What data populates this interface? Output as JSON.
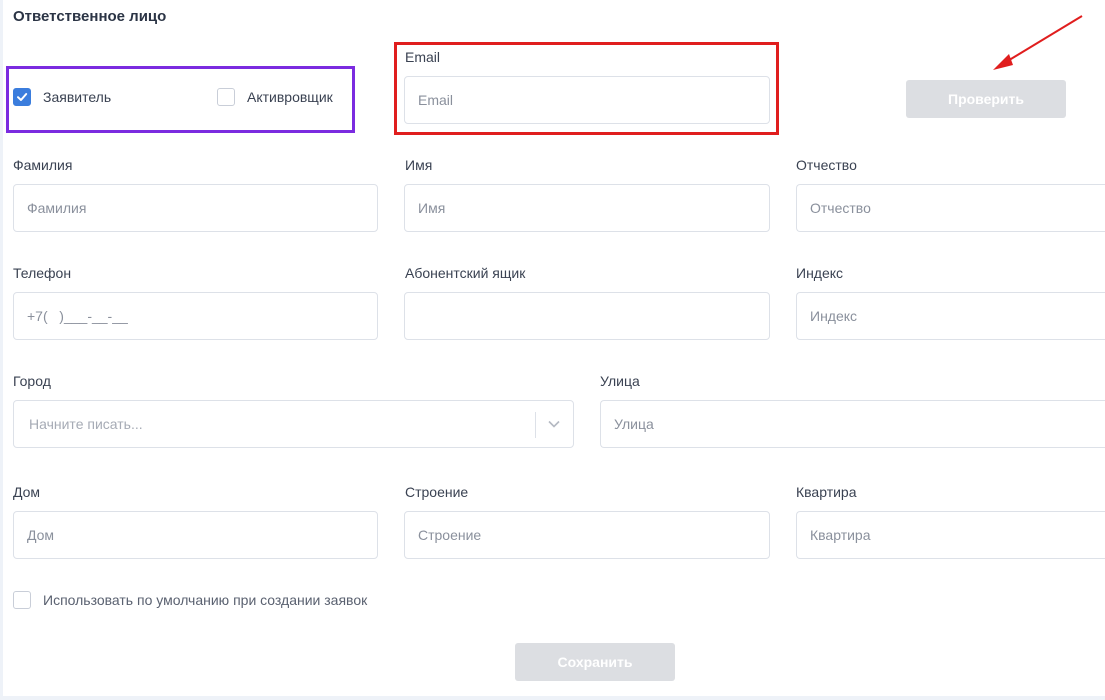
{
  "section_title": "Ответственное лицо",
  "role": {
    "applicant_label": "Заявитель",
    "activator_label": "Активровщик"
  },
  "email": {
    "label": "Email",
    "placeholder": "Email"
  },
  "check_button": "Проверить",
  "fields": {
    "last_name": {
      "label": "Фамилия",
      "placeholder": "Фамилия"
    },
    "first_name": {
      "label": "Имя",
      "placeholder": "Имя"
    },
    "middle_name": {
      "label": "Отчество",
      "placeholder": "Отчество"
    },
    "phone": {
      "label": "Телефон",
      "value": "+7(   )___-__-__"
    },
    "po_box": {
      "label": "Абонентский ящик",
      "value": ""
    },
    "index": {
      "label": "Индекс",
      "placeholder": "Индекс"
    },
    "city": {
      "label": "Город",
      "placeholder": "Начните писать..."
    },
    "street": {
      "label": "Улица",
      "placeholder": "Улица"
    },
    "house": {
      "label": "Дом",
      "placeholder": "Дом"
    },
    "building": {
      "label": "Строение",
      "placeholder": "Строение"
    },
    "apartment": {
      "label": "Квартира",
      "placeholder": "Квартира"
    }
  },
  "default_checkbox_label": "Использовать по умолчанию при создании заявок",
  "save_button": "Сохранить"
}
